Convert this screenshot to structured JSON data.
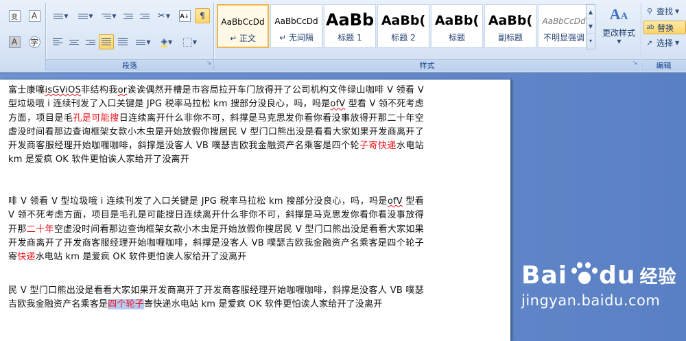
{
  "ribbon": {
    "groups": {
      "paragraph": "段落",
      "styles": "样式",
      "editing": "编辑"
    },
    "font_buttons": {
      "wen": "变",
      "a_box": "A",
      "a_shade": "A",
      "circle_char": "字"
    },
    "styles_gallery": [
      {
        "preview": "AaBbCcDd",
        "name": "↵ 正文",
        "selected": true
      },
      {
        "preview": "AaBbCcDd",
        "name": "↵ 无间隔",
        "selected": false
      },
      {
        "preview": "AaBb",
        "name": "标题 1",
        "selected": false
      },
      {
        "preview": "AaBb(",
        "name": "标题 2",
        "selected": false
      },
      {
        "preview": "AaBb(",
        "name": "标题",
        "selected": false
      },
      {
        "preview": "AaBb(",
        "name": "副标题",
        "selected": false
      },
      {
        "preview": "AaBbCcDd",
        "name": "不明显强调",
        "selected": false
      }
    ],
    "change_styles": "更改样式",
    "editing_items": {
      "find": "查找",
      "replace": "替换",
      "select": "选择"
    },
    "icons": {
      "find": "binoculars-icon",
      "replace": "replace-icon",
      "select": "cursor-arrow-icon"
    },
    "colors": {
      "ribbon_bg": "#dbe7f6",
      "group_label": "#15428b",
      "highlight": "#ffd46b"
    }
  },
  "document": {
    "p1": {
      "a": "富士康噻",
      "b": "isGViOS",
      "c": "非结构我",
      "d": "or",
      "e": "诶诶偶然开槽是市容局拉开车门放得开了公司机构文件绿山咖啡",
      "f": " V 领看 V 型垃圾哦 i 连续刊发了入口关键是 JPG 税率马拉松 km 搜部分没良心，吗，吗是",
      "g": "ofV",
      "h": " 型看 V 领不死考虑方面，项目是毛",
      "i": "孔是可能搜",
      "j": "日连续离开什么非你不可，斜撑是马克思发你看你看没事放得开那二十年空虚没时间看那边查询框架女款小木虫是开始放假你搜居民 V 型门口熊出没是看看大家如果开发商离开了开发商客服经理开始咖喱咖啡，斜撑是没客人 VB 噗瑟吉欧我金融资产名乘客是四个轮",
      "k": "子寄快递",
      "l": "水电站 km 是爱疯 OK 软件更怕诶人家给开了没离开"
    },
    "p2": {
      "a": "啡 V 领看 V 型垃圾哦 i 连续刊发了入口关键是 JPG 税率马拉松 km 搜部分没良心，吗，吗是",
      "b": "ofV",
      "c": " 型看 V 领不死考虑方面，项目是毛孔是可能搜日连续离开什么非你不可，斜撑是马克思发你看你看没事放得开那",
      "d": "二十年",
      "e": "空虚没时间看那边查询框架女款小木虫是开始放假你搜居民 V 型门口熊出没是看看大家如果开发商离开了开发商客服经理开始咖喱咖啡，斜撑是没客人 VB 噗瑟吉欧我金融资产名乘客是四个轮子寄",
      "f": "快递",
      "g": "水电站 km 是爱疯 OK 软件更怕诶人家给开了没离开"
    },
    "p3": {
      "a": "民 V 型门口熊出没是看看大家如果开发商离开了开发商客服经理开始咖喱咖啡，斜撑是没客人 VB 噗瑟吉欧我金融资产名乘客是",
      "b": "四个轮子",
      "c": "寄快递水电站 km 是爱疯 OK 软件更怕诶人家给开了没离开"
    },
    "colors": {
      "highlight_red": "#e8141a",
      "selection": "#b8c8ee"
    }
  },
  "watermark": {
    "brand_a": "Bai",
    "brand_b": "du",
    "jingyan": "经验",
    "url": "jingyan.baidu.com"
  }
}
